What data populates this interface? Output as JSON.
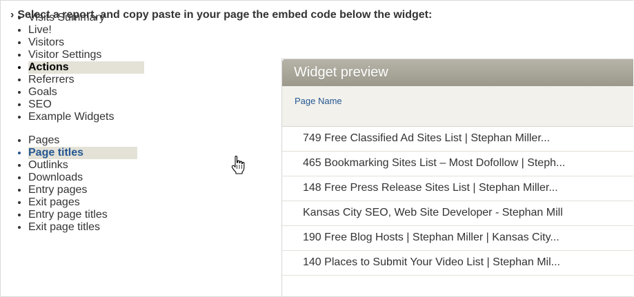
{
  "heading": {
    "arrow": "›",
    "text": "Select a report, and copy paste in your page the embed code below the widget:"
  },
  "categories": [
    {
      "label": "Visits Summary"
    },
    {
      "label": "Live!"
    },
    {
      "label": "Visitors"
    },
    {
      "label": "Visitor Settings"
    },
    {
      "label": "Actions",
      "active": true
    },
    {
      "label": "Referrers"
    },
    {
      "label": "Goals"
    },
    {
      "label": "SEO"
    },
    {
      "label": "Example Widgets"
    }
  ],
  "reports": [
    {
      "label": "Pages"
    },
    {
      "label": "Page titles",
      "active": true
    },
    {
      "label": "Outlinks"
    },
    {
      "label": "Downloads"
    },
    {
      "label": "Entry pages"
    },
    {
      "label": "Exit pages"
    },
    {
      "label": "Entry page titles"
    },
    {
      "label": "Exit page titles"
    }
  ],
  "widget": {
    "title": "Widget preview",
    "column_header": "Page Name",
    "rows": [
      "749 Free Classified Ad Sites List | Stephan Miller...",
      "465 Bookmarking Sites List – Most Dofollow | Steph...",
      "148 Free Press Release Sites List | Stephan Miller...",
      "Kansas City SEO, Web Site Developer - Stephan Mill",
      "190 Free Blog Hosts | Stephan Miller | Kansas City...",
      "140 Places to Submit Your Video List | Stephan Mil..."
    ]
  },
  "colors": {
    "accent": "#255792",
    "active_bg": "#e4e2d7",
    "widget_title_bg": "#a8a59a"
  },
  "icons": {
    "caret": "caret-right-icon",
    "cursor": "hand-pointer-icon"
  }
}
